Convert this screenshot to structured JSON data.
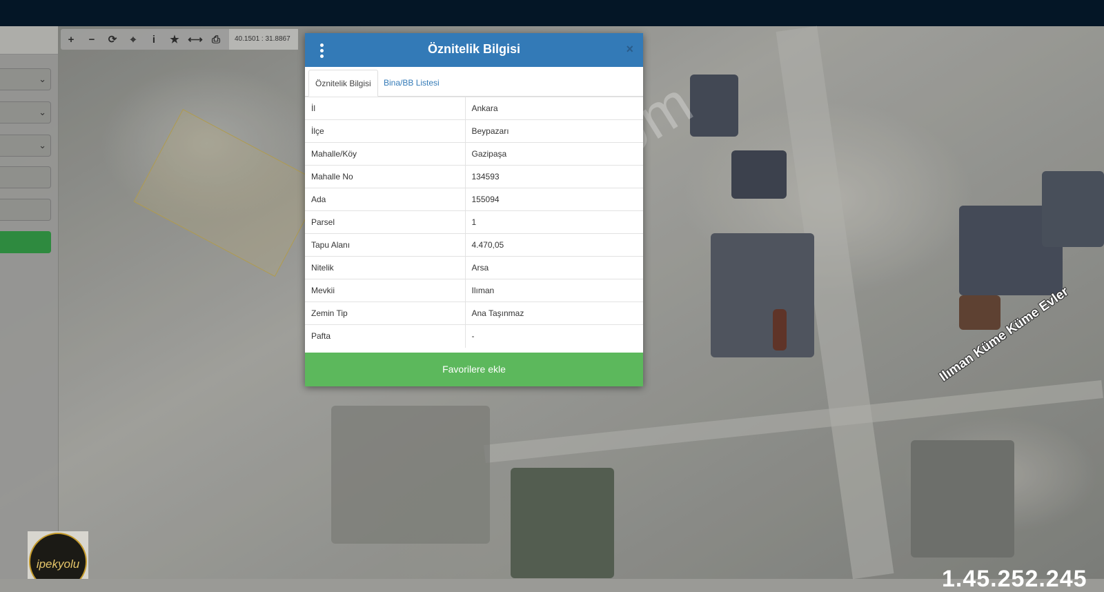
{
  "toolbar": {
    "buttons": [
      {
        "name": "zoom-in",
        "glyph": "+"
      },
      {
        "name": "zoom-out",
        "glyph": "−"
      },
      {
        "name": "refresh",
        "glyph": "⟳"
      },
      {
        "name": "locate",
        "glyph": "⌖"
      },
      {
        "name": "info",
        "glyph": "i"
      },
      {
        "name": "favorite",
        "glyph": "★"
      },
      {
        "name": "measure",
        "glyph": "⟷"
      },
      {
        "name": "print",
        "glyph": "⎙"
      }
    ],
    "coordinates": "40.1501 : 31.8867"
  },
  "modal": {
    "title": "Öznitelik Bilgisi",
    "close_glyph": "×",
    "tabs": [
      "Öznitelik Bilgisi",
      "Bina/BB Listesi"
    ],
    "active_tab": 0,
    "rows": [
      {
        "label": "İl",
        "value": "Ankara"
      },
      {
        "label": "İlçe",
        "value": "Beypazarı"
      },
      {
        "label": "Mahalle/Köy",
        "value": "Gazipaşa"
      },
      {
        "label": "Mahalle No",
        "value": "134593"
      },
      {
        "label": "Ada",
        "value": "155094"
      },
      {
        "label": "Parsel",
        "value": "1"
      },
      {
        "label": "Tapu Alanı",
        "value": "4.470,05"
      },
      {
        "label": "Nitelik",
        "value": "Arsa"
      },
      {
        "label": "Mevkii",
        "value": "Ilıman"
      },
      {
        "label": "Zemin Tip",
        "value": "Ana Taşınmaz"
      },
      {
        "label": "Pafta",
        "value": "-"
      }
    ],
    "favorite_button": "Favorilere ekle"
  },
  "map": {
    "road_label": "Ilıman Küme Küme Evler",
    "watermark": "emlakjet.com",
    "corner_text": "1.45.252.245"
  },
  "logo": {
    "text": "ipekyolu"
  },
  "colors": {
    "topbar": "#041626",
    "modal_header": "#337ab7",
    "favorite_button": "#5cb85c",
    "tab_link": "#337ab7"
  }
}
